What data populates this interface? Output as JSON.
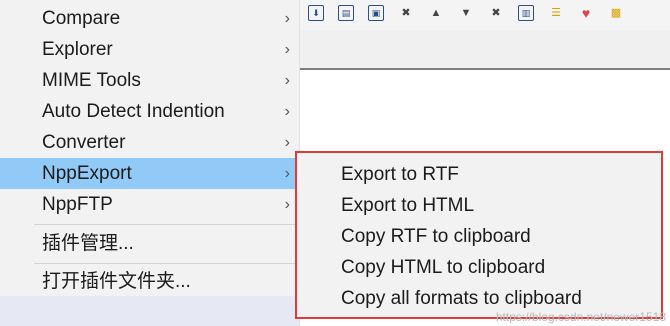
{
  "toolbar": {
    "icons": [
      {
        "name": "bookmark-icon",
        "glyph": "⬇"
      },
      {
        "name": "panel-icon",
        "glyph": "▤"
      },
      {
        "name": "monitor-icon",
        "glyph": "▣"
      },
      {
        "name": "macro-icon",
        "glyph": "✖"
      },
      {
        "name": "triangle-up-icon",
        "glyph": "▲"
      },
      {
        "name": "triangle-down-icon",
        "glyph": "▼"
      },
      {
        "name": "playback-icon",
        "glyph": "✖"
      },
      {
        "name": "document-icon",
        "glyph": "▥"
      },
      {
        "name": "spellcheck-icon",
        "glyph": "☰"
      },
      {
        "name": "heart-icon",
        "glyph": "♥"
      },
      {
        "name": "folder-icon",
        "glyph": "▩"
      }
    ]
  },
  "plugins_menu": {
    "items": [
      {
        "label": "Compare",
        "arrow": "›"
      },
      {
        "label": "Explorer",
        "arrow": "›"
      },
      {
        "label": "MIME Tools",
        "arrow": "›"
      },
      {
        "label": "Auto Detect Indention",
        "arrow": "›"
      },
      {
        "label": "Converter",
        "arrow": "›"
      },
      {
        "label": "NppExport",
        "arrow": "›"
      },
      {
        "label": "NppFTP",
        "arrow": "›"
      },
      {
        "label": "插件管理..."
      },
      {
        "label": "打开插件文件夹..."
      }
    ],
    "selected_index": 5
  },
  "nppexport_submenu": {
    "items": [
      {
        "label": "Export to RTF"
      },
      {
        "label": "Export to HTML"
      },
      {
        "label": "Copy RTF to clipboard"
      },
      {
        "label": "Copy HTML to clipboard"
      },
      {
        "label": "Copy all formats to clipboard"
      }
    ]
  },
  "watermark": "https://blog.csdn.net/newer1518",
  "colors": {
    "selected_bg": "#91c9f7",
    "highlight_border": "#e03a3a",
    "menu_bg": "#f2f2f2"
  }
}
